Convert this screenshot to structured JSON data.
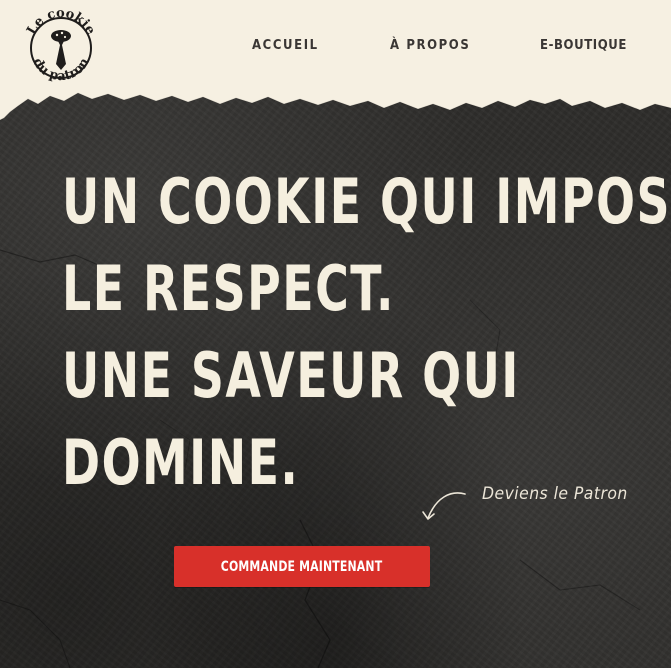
{
  "logo": {
    "line1": "Le cookie",
    "line2": "du patron",
    "icon": "tie-icon"
  },
  "nav": {
    "items": [
      {
        "label": "ACCUEIL"
      },
      {
        "label": "À PROPOS"
      },
      {
        "label": "E-BOUTIQUE"
      }
    ]
  },
  "hero": {
    "lines": [
      "UN COOKIE QUI IMPOSE",
      "LE RESPECT.",
      "UNE SAVEUR QUI",
      "DOMINE."
    ]
  },
  "tagline": "Deviens le Patron",
  "cta": {
    "label": "COMMANDE MAINTENANT"
  },
  "colors": {
    "cream": "#f5efdf",
    "dark_bg": "#2e2d2b",
    "cta_red": "#d8302a",
    "nav_text": "#3a3634"
  }
}
